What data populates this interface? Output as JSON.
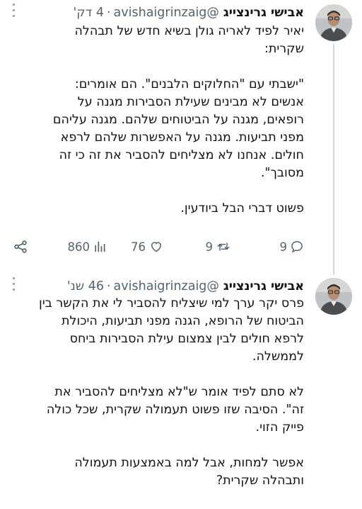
{
  "tweets": [
    {
      "name": "אבישי גרינצייג",
      "handle": "@avishaigrinzaig",
      "time": "4 דק'",
      "lines": [
        "יאיר לפיד לאריה גולן בשיא חדש של תבהלה",
        "שקרית:",
        "",
        "\"ישבתי עם \"החלוקים הלבנים\". הם אומרים:",
        "אנשים לא מבינים שעילת הסבירות מגנה על",
        "רופאים, מגנה על הביטוחים שלהם. מגנה עליהם",
        "מפני תביעות. מגנה על האפשרות שלהם לרפא",
        "חולים. אנחנו לא מצליחים להסביר את זה כי זה",
        "מסובך\".",
        "",
        "פשוט דברי הבל ביודעין."
      ],
      "stats": {
        "replies": "9",
        "retweets": "9",
        "likes": "76",
        "views": "860"
      }
    },
    {
      "name": "אבישי גרינצייג",
      "handle": "@avishaigrinzaig",
      "time": "46 שנ'",
      "lines": [
        "פרס יקר ערך למי שיצליח להסביר לי את הקשר בין",
        "הביטוח של הרופא, הגנה מפני תביעות, היכולת",
        "לרפא חולים לבין צמצום עילת הסבירות ביחס",
        "לממשלה.",
        "",
        "לא סתם לפיד אומר ש\"לא מצליחים להסביר את",
        "זה\". הסיבה שזו פשוט תעמולה שקרית, שכל כולה",
        "פייק הזוי.",
        "",
        "אפשר למחות, אבל למה באמצעות תעמולה",
        "ותבהלה שקרית?"
      ]
    }
  ]
}
